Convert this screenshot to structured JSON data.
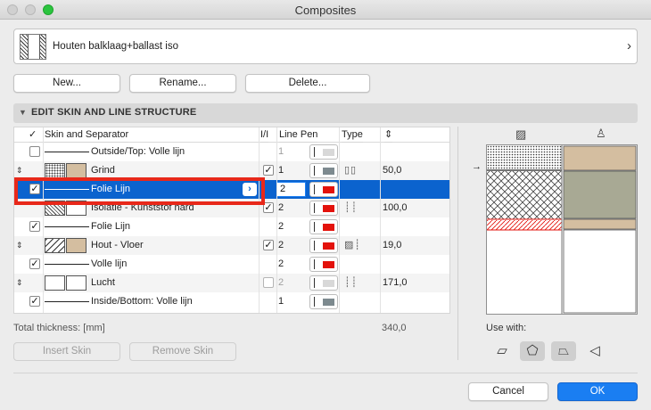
{
  "window": {
    "title": "Composites"
  },
  "composite": {
    "name": "Houten balklaag+ballast iso",
    "chevron": "›"
  },
  "buttons": {
    "new": "New...",
    "rename": "Rename...",
    "delete": "Delete...",
    "insert_skin": "Insert Skin",
    "remove_skin": "Remove Skin",
    "cancel": "Cancel",
    "ok": "OK"
  },
  "section": {
    "title": "EDIT SKIN AND LINE STRUCTURE"
  },
  "table": {
    "headers": {
      "check": "✓",
      "skin": "Skin and Separator",
      "flag": "I/I",
      "line_pen": "Line Pen",
      "type": "Type",
      "thickness_icon": "⇕"
    },
    "rows": [
      {
        "name": "Outside/Top: Volle lijn",
        "pen": "1",
        "thickness": "",
        "checked": "",
        "flag": ""
      },
      {
        "name": "Grind",
        "pen": "1",
        "thickness": "50,0",
        "checked": "",
        "flag": "✓"
      },
      {
        "name": "Folie Lijn",
        "pen": "2",
        "thickness": "",
        "checked": "✓",
        "flag": ""
      },
      {
        "name": "Isolatie - Kunststof hard",
        "pen": "2",
        "thickness": "100,0",
        "checked": "",
        "flag": "✓"
      },
      {
        "name": "Folie Lijn",
        "pen": "2",
        "thickness": "",
        "checked": "✓",
        "flag": ""
      },
      {
        "name": "Hout - Vloer",
        "pen": "2",
        "thickness": "19,0",
        "checked": "",
        "flag": "✓"
      },
      {
        "name": "Volle lijn",
        "pen": "2",
        "thickness": "",
        "checked": "✓",
        "flag": ""
      },
      {
        "name": "Lucht",
        "pen": "2",
        "thickness": "171,0",
        "checked": "",
        "flag": ""
      },
      {
        "name": "Inside/Bottom: Volle lijn",
        "pen": "1",
        "thickness": "",
        "checked": "✓",
        "flag": ""
      }
    ],
    "selected_row_chevron": "›",
    "arrow_updown": "⇕"
  },
  "totals": {
    "label": "Total thickness: [mm]",
    "value": "340,0"
  },
  "preview": {
    "use_with": "Use with:"
  },
  "colors": {
    "accent": "#0b63ce",
    "highlight": "#e8281a",
    "pen_red": "#e3120b",
    "pen_gray": "#7d8a8f",
    "tan": "#d4bea0",
    "olive": "#a8a994"
  }
}
